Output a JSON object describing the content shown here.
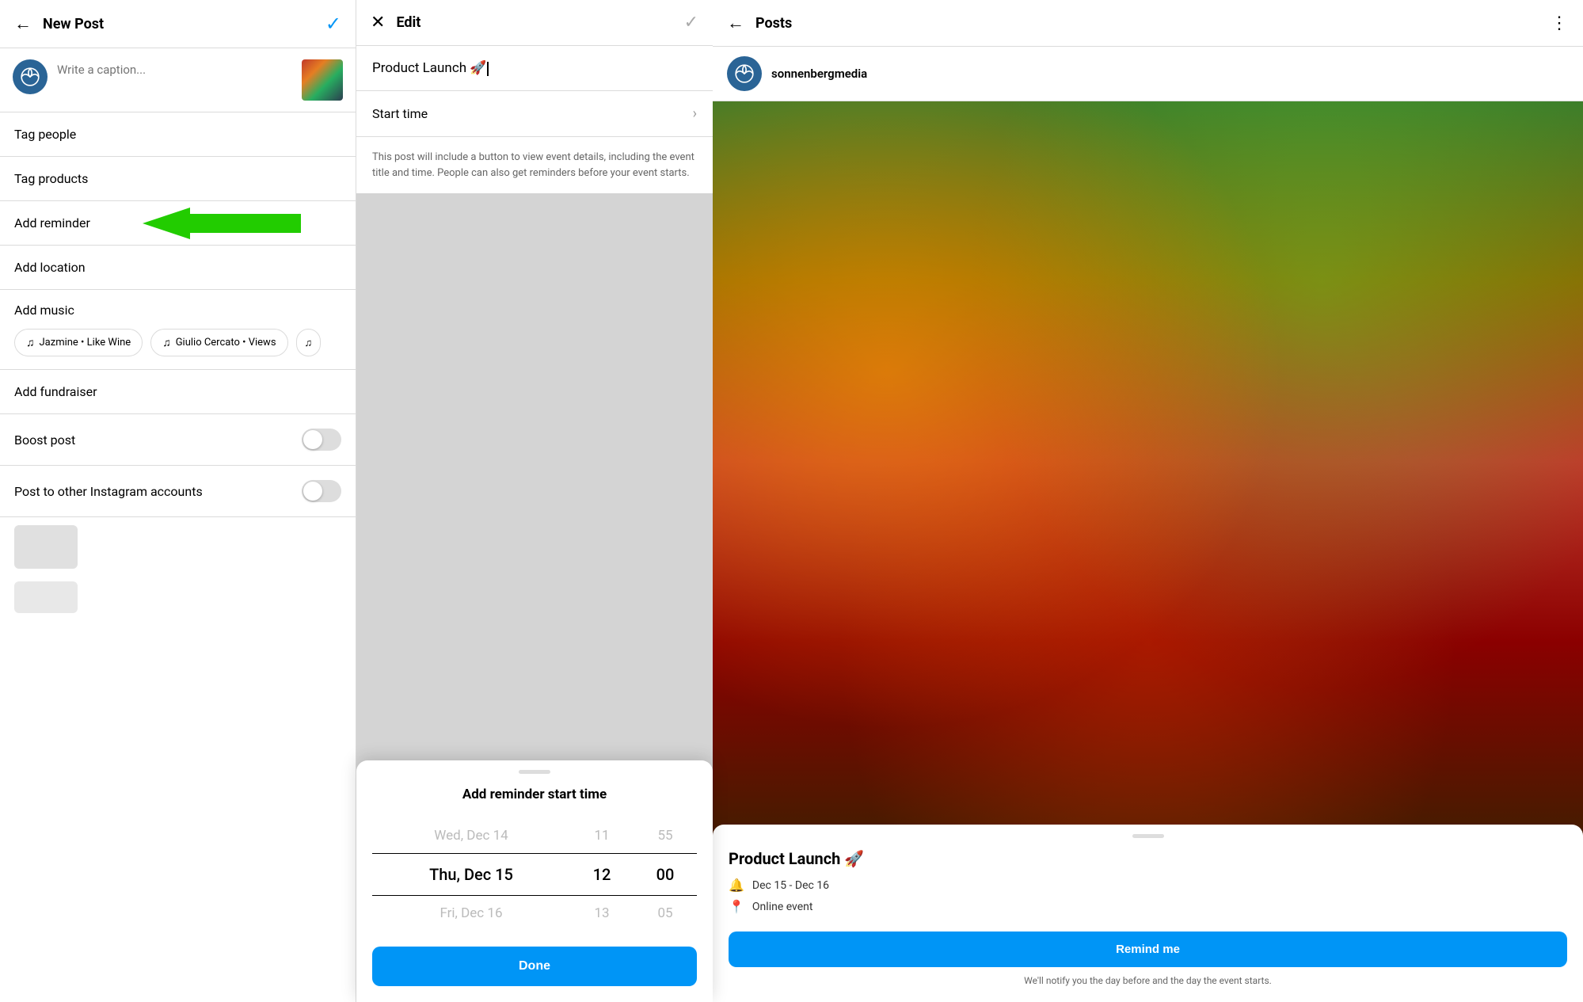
{
  "panel1": {
    "header": {
      "title": "New Post",
      "back_label": "←",
      "check_label": "✓"
    },
    "caption": {
      "placeholder": "Write a caption...",
      "alt": "Write & caption _"
    },
    "menu_items": [
      {
        "id": "tag-people",
        "label": "Tag people"
      },
      {
        "id": "tag-products",
        "label": "Tag products"
      },
      {
        "id": "add-reminder",
        "label": "Add reminder"
      },
      {
        "id": "add-location",
        "label": "Add location"
      }
    ],
    "music": {
      "label": "Add music",
      "chips": [
        {
          "id": "chip1",
          "text": "Jazmine • Like Wine"
        },
        {
          "id": "chip2",
          "text": "Giulio Cercato • Views"
        }
      ]
    },
    "toggles": [
      {
        "id": "boost-post",
        "label": "Boost post",
        "value": false
      },
      {
        "id": "other-accounts",
        "label": "Post to other Instagram accounts",
        "value": false
      }
    ]
  },
  "panel2": {
    "header": {
      "title": "Edit",
      "x_label": "✕",
      "check_label": "✓"
    },
    "event_title": "Product Launch 🚀",
    "start_time_label": "Start time",
    "description": "This post will include a button to view event details, including the event title and time. People can also get reminders before your event starts.",
    "sheet": {
      "title": "Add reminder start time",
      "date_rows": [
        {
          "date": "Wed, Dec 14",
          "hour": "11",
          "minute": "55",
          "selected": false
        },
        {
          "date": "Thu, Dec 15",
          "hour": "12",
          "minute": "00",
          "selected": true
        },
        {
          "date": "Fri, Dec 16",
          "hour": "13",
          "minute": "05",
          "selected": false
        }
      ],
      "done_label": "Done"
    }
  },
  "panel3": {
    "header": {
      "title": "Posts",
      "back_label": "←",
      "dots_label": "⋮"
    },
    "user": {
      "name": "sonnenbergmedia"
    },
    "card": {
      "title": "Product Launch 🚀",
      "date_range": "Dec 15 - Dec 16",
      "location": "Online event",
      "remind_label": "Remind me",
      "notify_text": "We'll notify you the day before and the day the event starts."
    }
  },
  "icons": {
    "back": "←",
    "check": "✓",
    "x": "✕",
    "chevron_right": "›",
    "three_dots": "⋮",
    "bell": "🔔",
    "pin": "📍",
    "music": "♫",
    "calendar": "📅"
  }
}
